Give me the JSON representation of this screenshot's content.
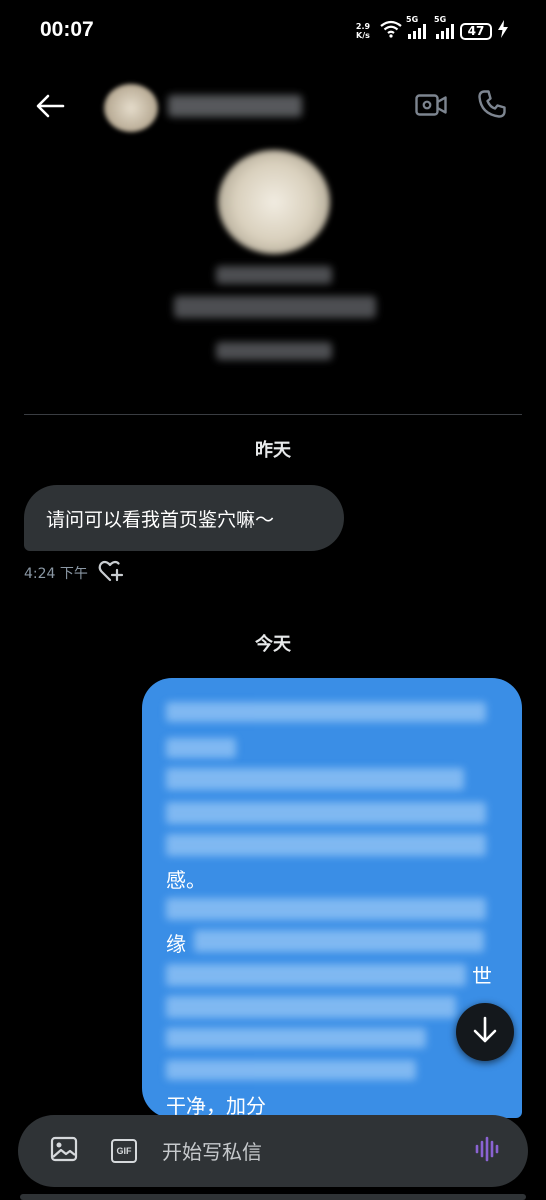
{
  "status_bar": {
    "time": "00:07",
    "net_speed_value": "2.9",
    "net_speed_unit": "K/s",
    "signal_1_label": "5G",
    "signal_2_label": "5G",
    "battery": "47"
  },
  "header": {
    "back_icon": "arrow-left-icon",
    "video_icon": "video-camera-icon",
    "call_icon": "phone-icon"
  },
  "conversation": {
    "yesterday_label": "昨天",
    "incoming_message": {
      "text": "请问可以看我首页鉴穴嘛～",
      "time": "4:24 下午",
      "reaction_icon": "heart-plus-icon"
    },
    "today_label": "今天",
    "outgoing_visible_fragments": {
      "frag_1": "感。",
      "frag_2": "缘",
      "frag_3": "干净，加分",
      "frag_4": "世"
    }
  },
  "scroll_down_icon": "arrow-down-icon",
  "composer": {
    "image_icon": "image-icon",
    "gif_label": "GIF",
    "placeholder": "开始写私信",
    "voice_icon": "voice-wave-icon"
  },
  "colors": {
    "background": "#000000",
    "incoming_bubble": "#2f3336",
    "outgoing_bubble": "#3a8ee6",
    "voice_accent": "#8a63d2"
  }
}
